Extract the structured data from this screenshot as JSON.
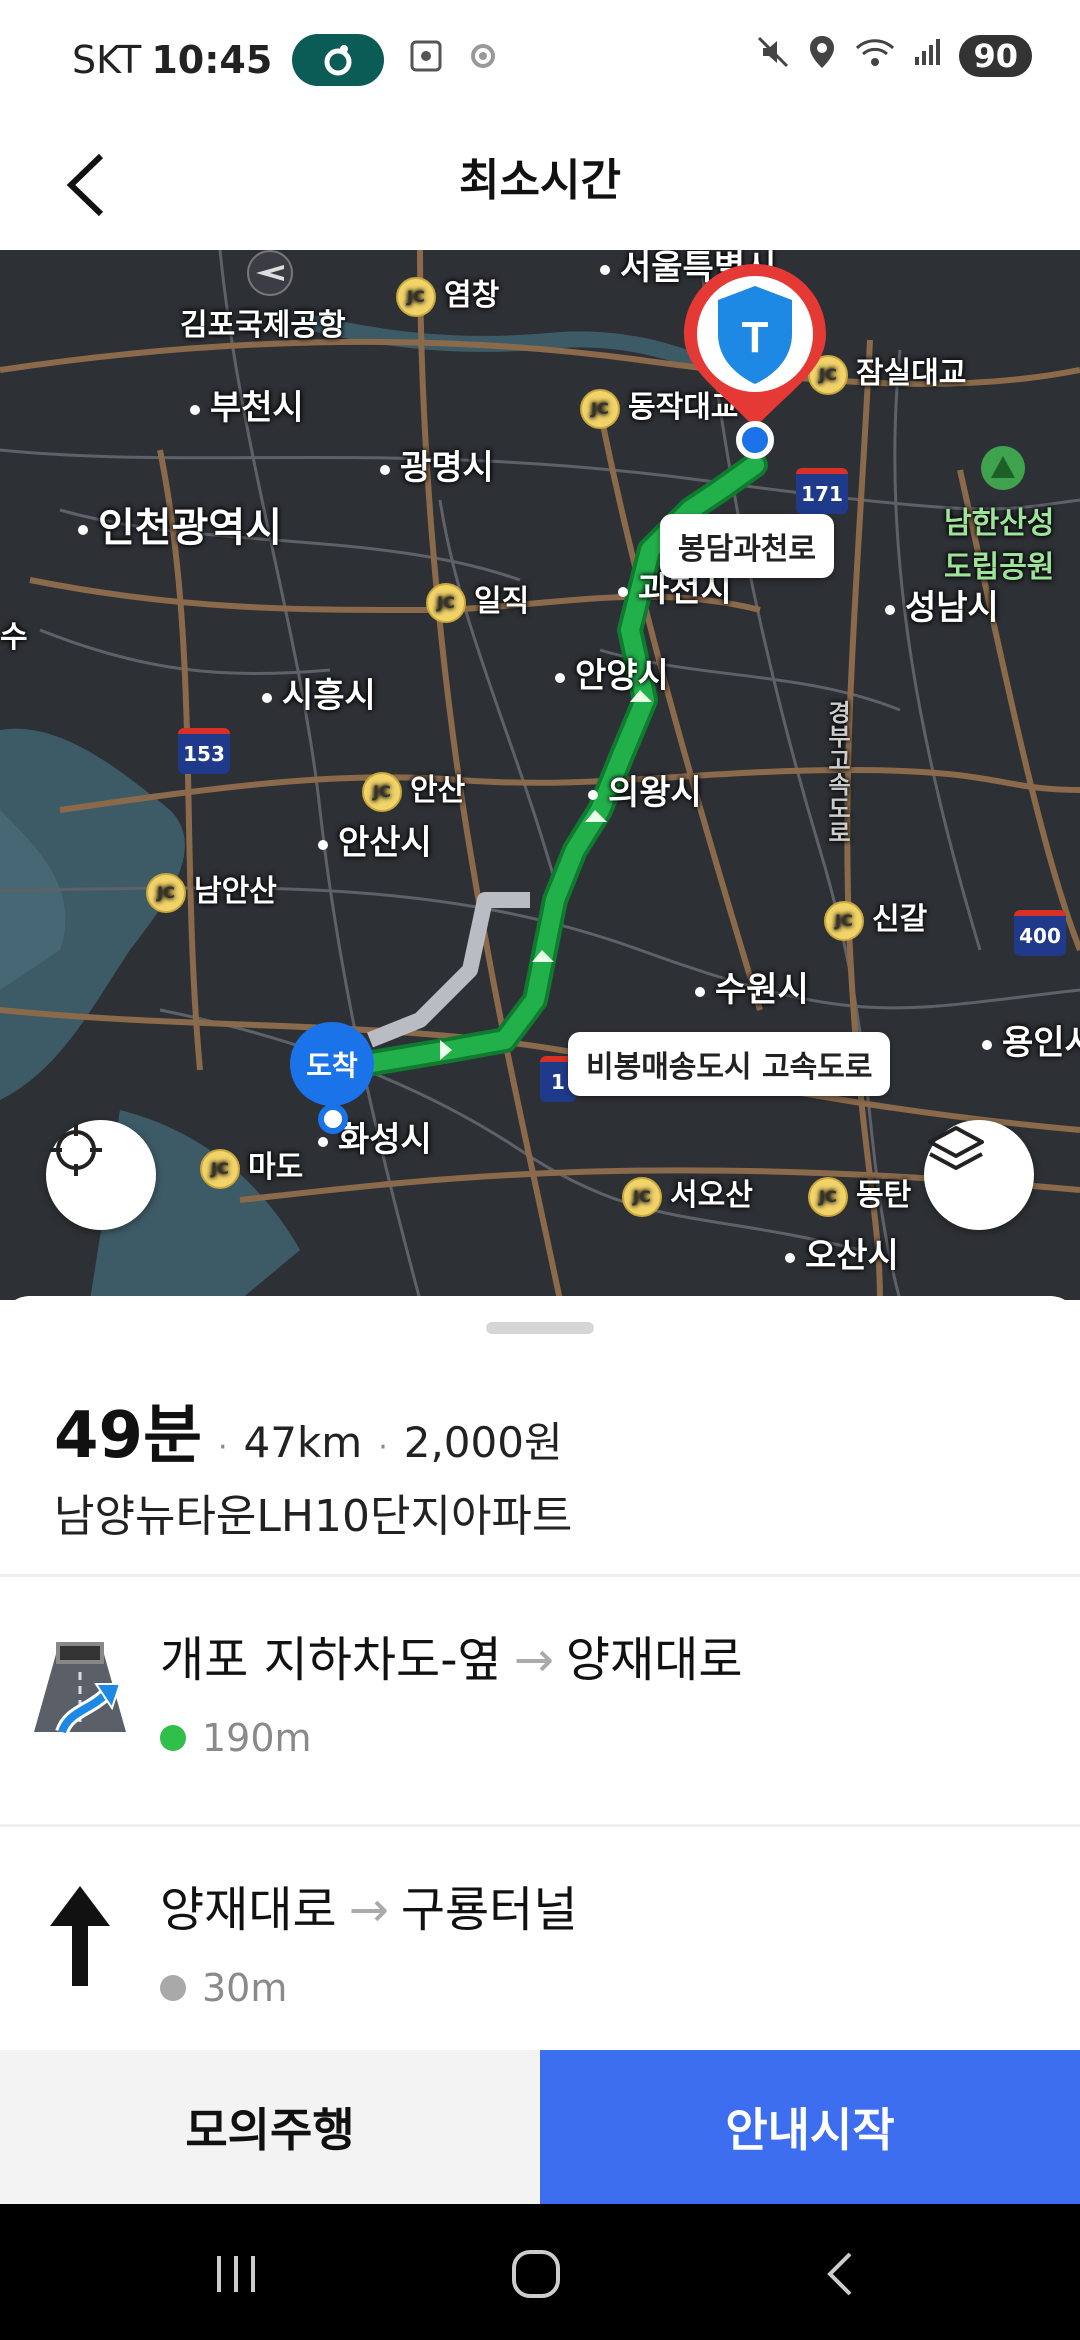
{
  "status_bar": {
    "carrier": "SKT",
    "time": "10:45",
    "battery": "90",
    "icons": [
      "tmap-active-pill-icon",
      "screenshot-icon",
      "sync-icon",
      "mute-icon",
      "location-icon",
      "wifi-icon",
      "signal-icon"
    ]
  },
  "header": {
    "back_icon": "chevron-left-icon",
    "title": "최소시간"
  },
  "map": {
    "labels": {
      "gimpo_airport": "김포국제공항",
      "bucheon": "부천시",
      "gwangmyeong": "광명시",
      "incheon": "인천광역시",
      "siheung": "시흥시",
      "ansan": "안산시",
      "anyang": "안양시",
      "uiwang": "의왕시",
      "gwacheon": "과천시",
      "seongnam": "성남시",
      "suwon": "수원시",
      "yongin": "용인시",
      "hwaseong": "화성시",
      "osan": "오산시",
      "namhansanseong": "남한산성\n도립공원",
      "seoul_top": "서울특별시",
      "gyeongbu": "경부고속도로",
      "su": "수",
      "yeomchang": "염창",
      "dongjakdaegyo": "동작대교",
      "jamsildaegyo": "잠실대교",
      "iljik": "일직",
      "ansan_jc": "안산",
      "namansan": "남안산",
      "singal": "신갈",
      "mado": "마도",
      "seoosan": "서오산",
      "dongtan": "동탄"
    },
    "jc_text": "JC",
    "shields": {
      "r171": "171",
      "r153": "153",
      "r400": "400",
      "r1": "1"
    },
    "callouts": {
      "bongdam": "봉담과천로",
      "bibong": "비봉매송도시 고속도로"
    },
    "destination_pin": "도착",
    "start_marker_icon": "tmap-shield-icon",
    "buttons": {
      "locate": "crosshair-icon",
      "layers": "layers-icon"
    },
    "colors": {
      "route": "#22b04b",
      "alt_route": "#b9bcc2",
      "land": "#2d3035",
      "water": "#3d5b66",
      "road": "#8a6a4a",
      "start_marker": "#e53935"
    }
  },
  "summary": {
    "duration": "49분",
    "distance": "47km",
    "fee": "2,000원",
    "destination": "남양뉴타운LH10단지아파트"
  },
  "steps": [
    {
      "from": "개포 지하차도-옆",
      "to": "양재대로",
      "distance": "190m",
      "bullet_color": "#2fbf4a",
      "icon": "underpass-right-turn-icon"
    },
    {
      "from": "양재대로",
      "to": "구룡터널",
      "distance": "30m",
      "bullet_color": "#a9a9a9",
      "icon": "straight-arrow-icon"
    }
  ],
  "arrow_glyph": "→",
  "actions": {
    "simulate": "모의주행",
    "start": "안내시작"
  },
  "nav_bar": [
    "recent-apps-icon",
    "home-icon",
    "back-icon"
  ]
}
